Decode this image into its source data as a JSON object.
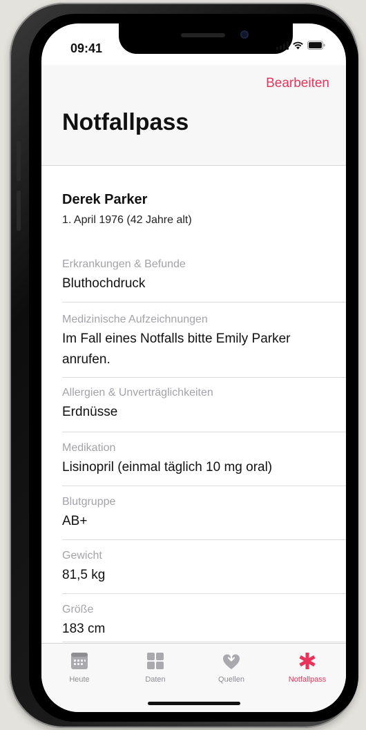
{
  "status_bar": {
    "time": "09:41"
  },
  "header": {
    "edit_label": "Bearbeiten",
    "title": "Notfallpass"
  },
  "person": {
    "name": "Derek Parker",
    "birth": "1. April 1976 (42 Jahre alt)"
  },
  "fields": [
    {
      "label": "Erkrankungen & Befunde",
      "value": "Bluthochdruck"
    },
    {
      "label": "Medizinische Aufzeichnungen",
      "value": "Im Fall eines Notfalls bitte Emily Parker anrufen."
    },
    {
      "label": "Allergien & Unverträglichkeiten",
      "value": "Erdnüsse"
    },
    {
      "label": "Medikation",
      "value": "Lisinopril (einmal täglich 10 mg oral)"
    },
    {
      "label": "Blutgruppe",
      "value": "AB+"
    },
    {
      "label": "Gewicht",
      "value": "81,5 kg"
    },
    {
      "label": "Größe",
      "value": "183 cm"
    }
  ],
  "tabs": [
    {
      "label": "Heute",
      "icon": "calendar-icon"
    },
    {
      "label": "Daten",
      "icon": "grid-icon"
    },
    {
      "label": "Quellen",
      "icon": "heart-arrow-icon"
    },
    {
      "label": "Notfallpass",
      "icon": "asterisk-icon",
      "active": true
    }
  ],
  "colors": {
    "accent": "#e8345b",
    "inactive": "#8e8e93"
  }
}
